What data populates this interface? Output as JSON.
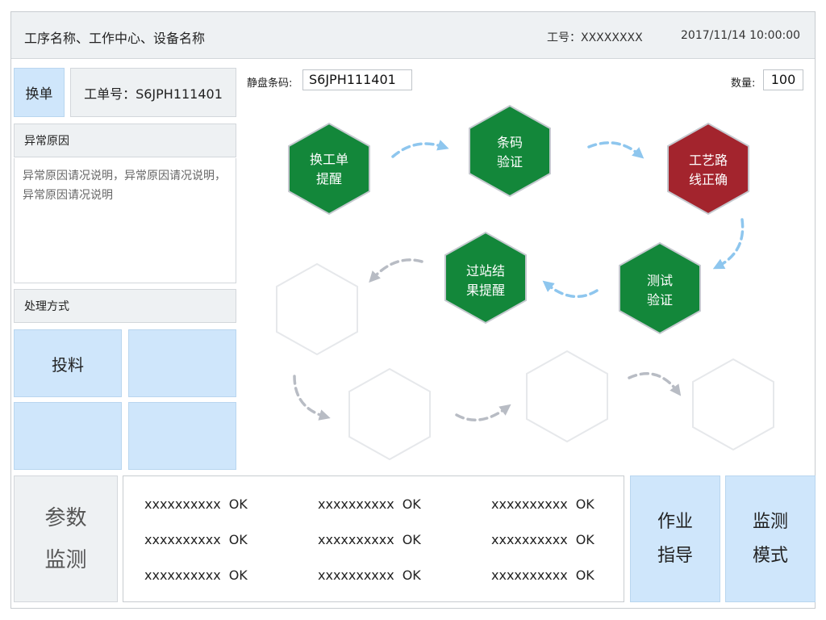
{
  "header": {
    "title": "工序名称、工作中心、设备名称",
    "worker_label": "工号：XXXXXXXX",
    "datetime": "2017/11/14  10:00:00"
  },
  "left": {
    "switch_label": "换单",
    "work_order": "工单号：S6JPH111401",
    "abnormal_title": "异常原因",
    "abnormal_text": "异常原因请况说明，异常原因请况说明，异常原因请况说明",
    "handling_title": "处理方式",
    "handling_buttons": [
      "投料",
      "",
      "",
      ""
    ]
  },
  "toolbar": {
    "barcode_label": "静盘条码:",
    "barcode_value": "S6JPH111401",
    "qty_label": "数量:",
    "qty_value": "100"
  },
  "flow": {
    "steps": [
      {
        "line1": "换工单",
        "line2": "提醒",
        "status": "ok"
      },
      {
        "line1": "条码",
        "line2": "验证",
        "status": "ok"
      },
      {
        "line1": "工艺路",
        "line2": "线正确",
        "status": "error"
      },
      {
        "line1": "测试",
        "line2": "验证",
        "status": "ok"
      },
      {
        "line1": "过站结",
        "line2": "果提醒",
        "status": "ok"
      },
      {
        "line1": "",
        "line2": "",
        "status": "pending"
      },
      {
        "line1": "",
        "line2": "",
        "status": "pending"
      },
      {
        "line1": "",
        "line2": "",
        "status": "pending"
      },
      {
        "line1": "",
        "line2": "",
        "status": "pending"
      }
    ],
    "colors": {
      "ok": "#13873a",
      "error": "#a3242d",
      "arrow_active": "#8ec6ee",
      "arrow_pending": "#b8bcc4"
    }
  },
  "params_button": {
    "line1": "参数",
    "line2": "监测"
  },
  "status_items": [
    {
      "name": "xxxxxxxxxx",
      "status": "OK"
    },
    {
      "name": "xxxxxxxxxx",
      "status": "OK"
    },
    {
      "name": "xxxxxxxxxx",
      "status": "OK"
    },
    {
      "name": "xxxxxxxxxx",
      "status": "OK"
    },
    {
      "name": "xxxxxxxxxx",
      "status": "OK"
    },
    {
      "name": "xxxxxxxxxx",
      "status": "OK"
    },
    {
      "name": "xxxxxxxxxx",
      "status": "OK"
    },
    {
      "name": "xxxxxxxxxx",
      "status": "OK"
    },
    {
      "name": "xxxxxxxxxx",
      "status": "OK"
    }
  ],
  "right_buttons": [
    {
      "line1": "作业",
      "line2": "指导"
    },
    {
      "line1": "监测",
      "line2": "模式"
    }
  ]
}
